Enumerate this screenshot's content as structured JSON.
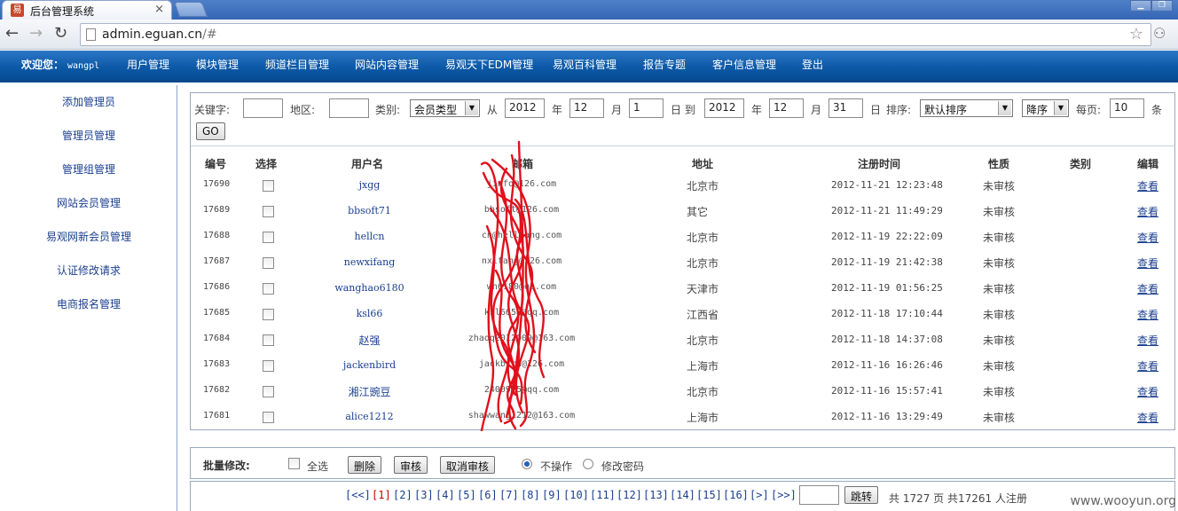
{
  "browser": {
    "tab_title": "后台管理系统",
    "tab_close": "×",
    "url_host": "admin.eguan.cn",
    "url_rest": "/#",
    "favicon_text": "易"
  },
  "header": {
    "welcome_label": "欢迎您：",
    "username": "wangpl",
    "menu": [
      "用户管理",
      "模块管理",
      "频道栏目管理",
      "网站内容管理",
      "易观天下EDM管理",
      "易观百科管理",
      "报告专题",
      "客户信息管理",
      "登出"
    ]
  },
  "sidebar": {
    "items": [
      "添加管理员",
      "管理员管理",
      "管理组管理",
      "网站会员管理",
      "易观网新会员管理",
      "认证修改请求",
      "电商报名管理"
    ]
  },
  "filters": {
    "keyword_label": "关键字:",
    "region_label": "地区:",
    "type_label": "类别:",
    "type_value": "会员类型",
    "from_label": "从",
    "from_year": "2012",
    "year_label": "年",
    "from_month": "12",
    "month_label": "月",
    "from_day": "1",
    "day_to_label": "日 到",
    "to_year": "2012",
    "to_month": "12",
    "to_day": "31",
    "day_label": "日",
    "sort_label": "排序:",
    "sort_value": "默认排序",
    "order_value": "降序",
    "per_page_label": "每页:",
    "per_page_value": "10",
    "per_page_unit": "条",
    "go_label": "GO"
  },
  "table": {
    "headers": [
      "编号",
      "选择",
      "用户名",
      "邮箱",
      "地址",
      "注册时间",
      "性质",
      "类别",
      "编辑"
    ],
    "rows": [
      {
        "id": "17690",
        "user": "jxgg",
        "email": "jinfo@126.com",
        "addr": "北京市",
        "time": "2012-11-21 12:23:48",
        "nature": "未审核",
        "type": "",
        "edit": "查看"
      },
      {
        "id": "17689",
        "user": "bbsoft71",
        "email": "bbsoft@126.com",
        "addr": "其它",
        "time": "2012-11-21 11:49:29",
        "nature": "未审核",
        "type": "",
        "edit": "查看"
      },
      {
        "id": "17688",
        "user": "hellcn",
        "email": "cn@hellfang.com",
        "addr": "北京市",
        "time": "2012-11-19 22:22:09",
        "nature": "未审核",
        "type": "",
        "edit": "查看"
      },
      {
        "id": "17687",
        "user": "newxifang",
        "email": "nxifang@126.com",
        "addr": "北京市",
        "time": "2012-11-19 21:42:38",
        "nature": "未审核",
        "type": "",
        "edit": "查看"
      },
      {
        "id": "17686",
        "user": "wanghao6180",
        "email": "wh6180@qq.com",
        "addr": "天津市",
        "time": "2012-11-19 01:56:25",
        "nature": "未审核",
        "type": "",
        "edit": "查看"
      },
      {
        "id": "17685",
        "user": "ksl66",
        "email": "ksl6658@qq.com",
        "addr": "江西省",
        "time": "2012-11-18 17:10:44",
        "nature": "未审核",
        "type": "",
        "edit": "查看"
      },
      {
        "id": "17684",
        "user": "赵强",
        "email": "zhaoq2012009@163.com",
        "addr": "北京市",
        "time": "2012-11-18 14:37:08",
        "nature": "未审核",
        "type": "",
        "edit": "查看"
      },
      {
        "id": "17683",
        "user": "jackenbird",
        "email": "jackbird@126.com",
        "addr": "上海市",
        "time": "2012-11-16 16:26:46",
        "nature": "未审核",
        "type": "",
        "edit": "查看"
      },
      {
        "id": "17682",
        "user": "湘江豌豆",
        "email": "2400915@qq.com",
        "addr": "北京市",
        "time": "2012-11-16 15:57:41",
        "nature": "未审核",
        "type": "",
        "edit": "查看"
      },
      {
        "id": "17681",
        "user": "alice1212",
        "email": "shawwang1212@163.com",
        "addr": "上海市",
        "time": "2012-11-16 13:29:49",
        "nature": "未审核",
        "type": "",
        "edit": "查看"
      }
    ]
  },
  "batch": {
    "label": "批量修改:",
    "select_all": "全选",
    "delete": "删除",
    "approve": "审核",
    "cancel_approve": "取消审核",
    "radio_none": "不操作",
    "radio_password": "修改密码"
  },
  "pager": {
    "first": "[<<]",
    "pages": [
      "[1]",
      "[2]",
      "[3]",
      "[4]",
      "[5]",
      "[6]",
      "[7]",
      "[8]",
      "[9]",
      "[10]",
      "[11]",
      "[12]",
      "[13]",
      "[14]",
      "[15]",
      "[16]"
    ],
    "next": "[>]",
    "last": "[>>]",
    "jump": "跳转",
    "summary": "共 1727 页 共17261 人注册"
  },
  "watermark": "www.wooyun.org",
  "colors": {
    "header_blue": "#0d5aa8",
    "link_blue": "#1a3f8f",
    "scribble_red": "#e0101c"
  }
}
